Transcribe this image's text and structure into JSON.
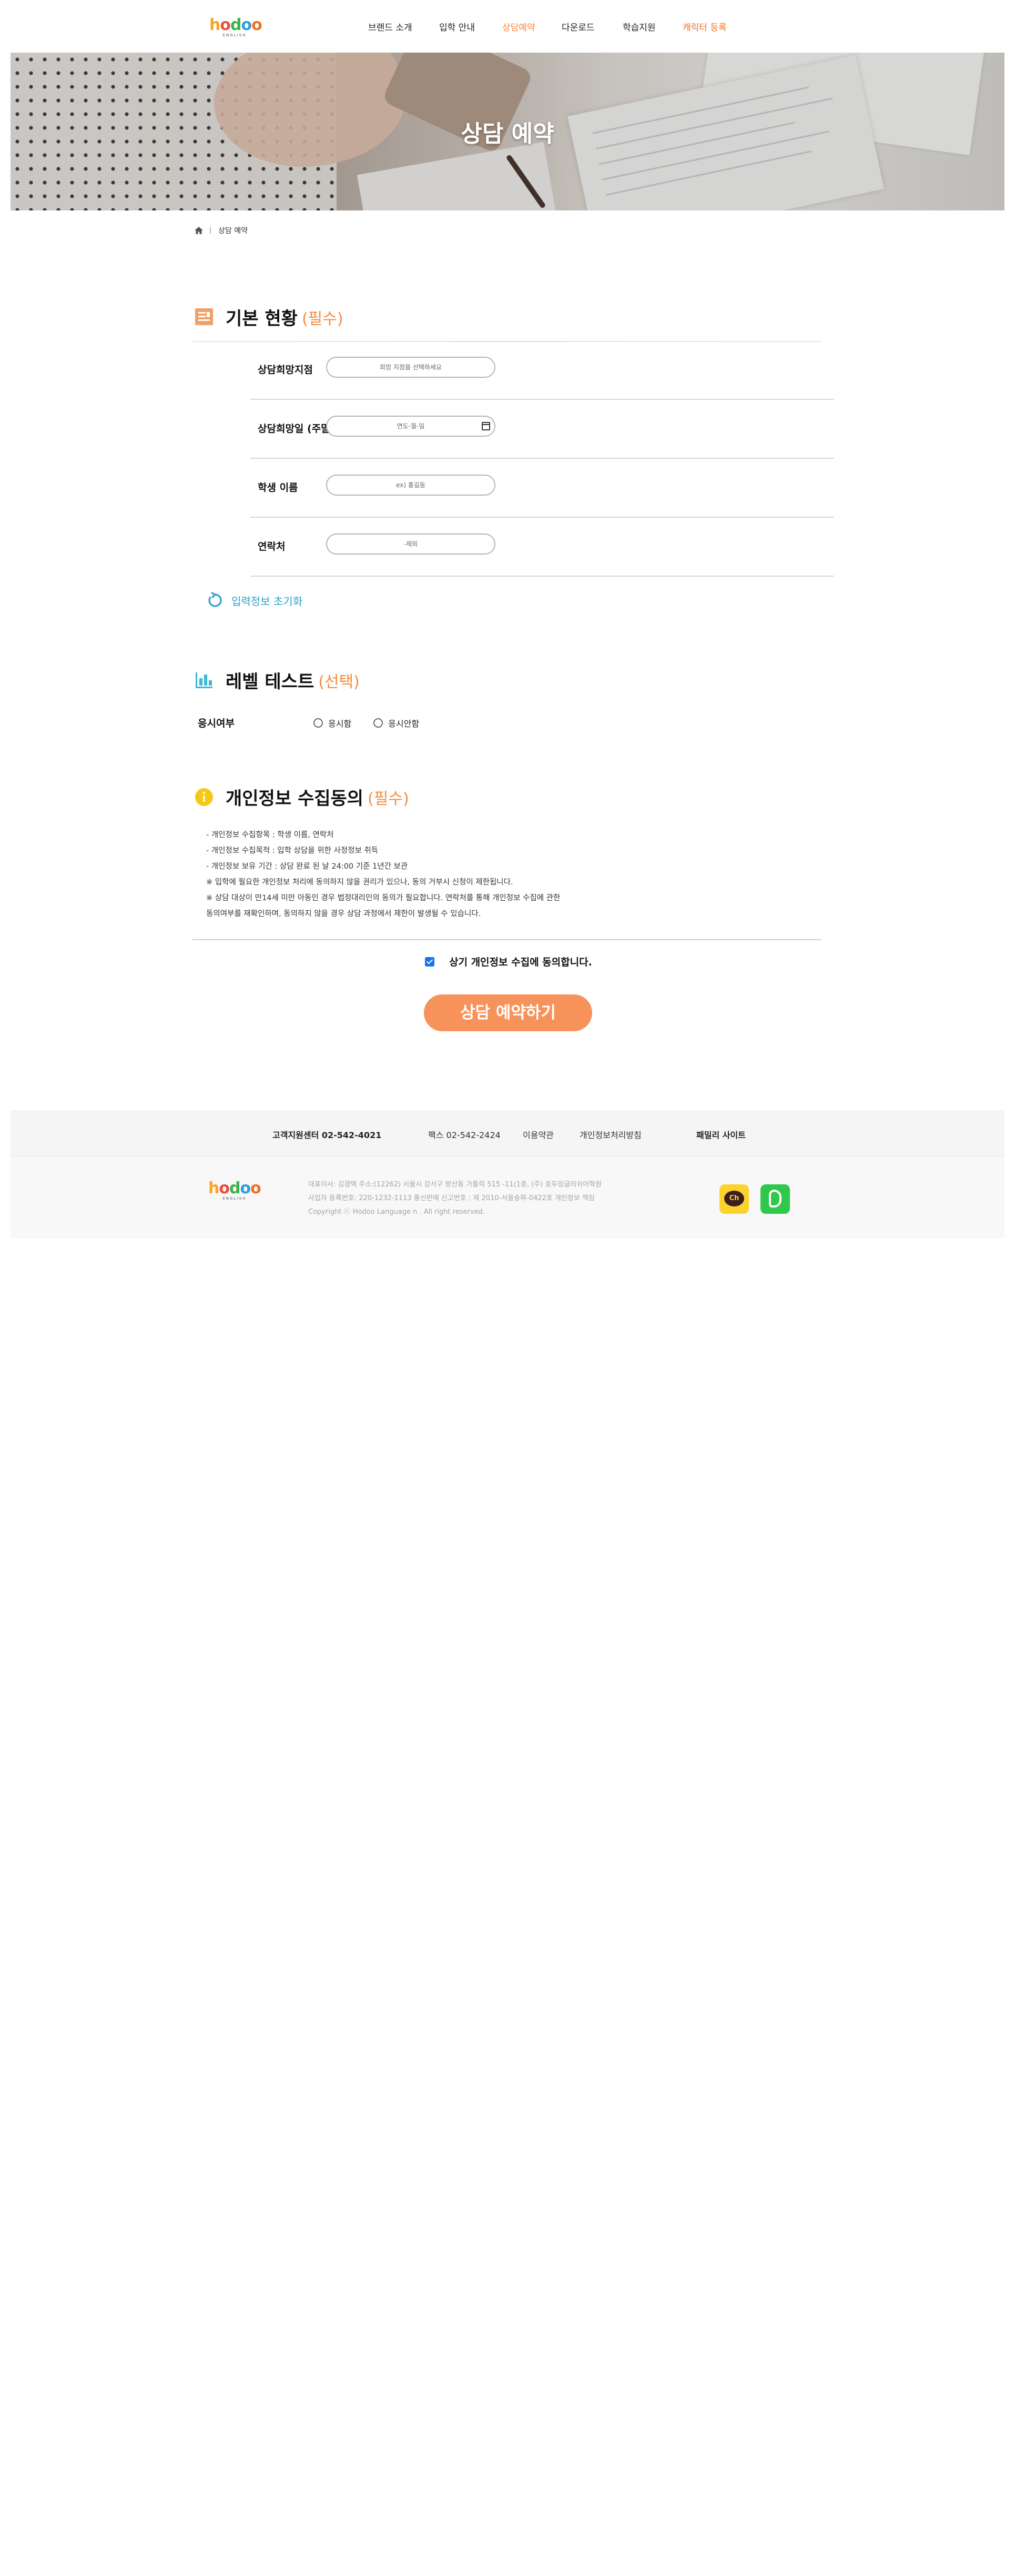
{
  "header": {
    "logo_text": "hodoo",
    "logo_sub": "ENGLISH",
    "nav": [
      {
        "label": "브랜드 소개"
      },
      {
        "label": "입학 안내"
      },
      {
        "label": "상담예약"
      },
      {
        "label": "다운로드"
      },
      {
        "label": "학습지원"
      },
      {
        "label": "캐릭터 등록"
      }
    ]
  },
  "hero": {
    "title": "상담 예약"
  },
  "breadcrumb": {
    "current": "상담 예약"
  },
  "basic": {
    "title": "기본 현황",
    "required": "(필수)",
    "rows": [
      {
        "label": "상담희망지점",
        "placeholder": "희망 지점을 선택하세요"
      },
      {
        "label": "상담희망일 (주말 제외)",
        "placeholder": "연도-월-일"
      },
      {
        "label": "학생 이름",
        "placeholder": "ex) 홍길동"
      },
      {
        "label": "연락처",
        "placeholder": "-제외"
      }
    ],
    "reset_label": "입력정보 초기화"
  },
  "level": {
    "title": "레벨 테스트",
    "optional": "(선택)",
    "label": "응시여부",
    "options": [
      "응시함",
      "응시안함"
    ]
  },
  "privacy": {
    "title": "개인정보 수집동의",
    "required": "(필수)",
    "lines": [
      "- 개인정보 수집항목 : 학생 이름, 연락처",
      "- 개인정보 수집목적 : 입학 상담을 위한 사정정보 취득",
      "- 개인정보 보유 기간 : 상담 완료 된 날 24:00 기준 1년간 보관",
      "※ 입학에 필요한 개인정보 처리에 동의하지 않을 권리가 있으나, 동의 거부시 신청이 제한됩니다.",
      "※ 상담 대상이 만14세 미만 아동인 경우 법정대리인의 동의가 필요합니다. 연락처를 통해 개인정보 수집에 관한",
      "동의여부를 재확인하며, 동의하지 않을 경우 상담 과정에서 제한이 발생될 수 있습니다."
    ],
    "agree_label": "상기 개인정보 수집에 동의합니다.",
    "submit_label": "상담 예약하기"
  },
  "footer": {
    "customer_center": "고객지원센터 02-542-4021",
    "fax": "팩스 02-542-2424",
    "terms": "이용약관",
    "privacy_policy": "개인정보처리방침",
    "family_site": "패밀리 사이트",
    "info_lines": [
      "대표이사: 김경택  주소:(12262) 서울시 강서구 방산동 가톨릭 515 -11(1층, (주) 호두잉글리쉬어학원",
      "사업자 등록번호: 220-1232-1113  통신판매 신고번호 : 제 2010-서울송파-0422호  개인정보 책임",
      "Copyright ⓒ Hodoo Language n . All right reserved."
    ],
    "kakao_label": "Ch"
  },
  "colors": {
    "accent_orange": "#f78a3c",
    "submit_orange": "#f7935a",
    "reset_blue": "#2aa3c8"
  },
  "icons": {
    "basic_section": "clipboard-icon",
    "level_section": "bar-chart-icon",
    "privacy_section": "info-icon",
    "reset": "refresh-icon",
    "breadcrumb_home": "home-icon"
  }
}
